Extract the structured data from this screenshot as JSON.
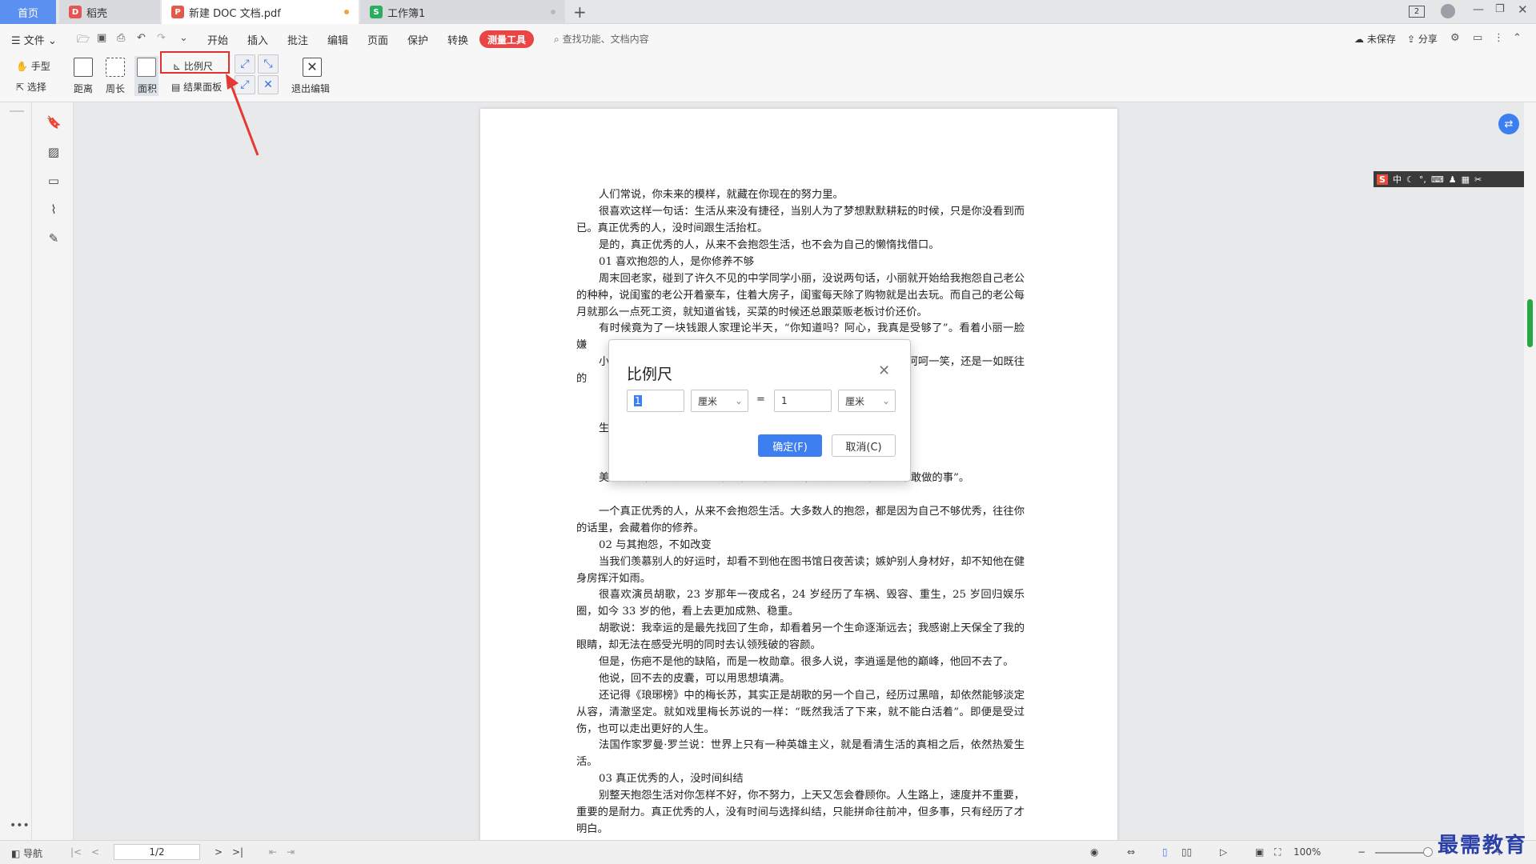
{
  "tabs": {
    "home": "首页",
    "t1": "稻壳",
    "t2": "新建 DOC 文档.pdf",
    "t3": "工作簿1",
    "add": "+"
  },
  "titlebar": {
    "badge": "2"
  },
  "menubar": {
    "file": "文件",
    "items": [
      "开始",
      "插入",
      "批注",
      "编辑",
      "页面",
      "保护",
      "转换"
    ],
    "active": "测量工具",
    "search_placeholder": "查找功能、文档内容",
    "unsaved": "未保存",
    "share": "分享"
  },
  "ribbon": {
    "hand": "手型",
    "select": "选择",
    "distance": "距离",
    "perimeter": "周长",
    "area": "面积",
    "scale": "比例尺",
    "result_panel": "结果面板",
    "exit_edit": "退出编辑"
  },
  "document": {
    "paragraphs": [
      "人们常说，你未来的模样，就藏在你现在的努力里。",
      "很喜欢这样一句话：生活从来没有捷径，当别人为了梦想默默耕耘的时候，只是你没看到而已。真正优秀的人，没时间跟生活抬杠。",
      "是的，真正优秀的人，从来不会抱怨生活，也不会为自己的懒惰找借口。",
      "01 喜欢抱怨的人，是你修养不够",
      "周末回老家，碰到了许久不见的中学同学小丽，没说两句话，小丽就开始给我抱怨自己老公的种种，说闺蜜的老公开着豪车，住着大房子，闺蜜每天除了购物就是出去玩。而自己的老公每月就那么一点死工资，就知道省钱，买菜的时候还总跟菜贩老板讨价还价。",
      "有时候竟为了一块钱跟人家理论半天，“你知道吗？阿心，我真是受够了”。看着小丽一脸嫌",
      "小                                                                                真心的好。还记得当初小丽经                                                                嫁了个好老公。可现在结婚还                                                                是呵呵一笑，还是一如既往的",
      "生                                                                                各种抱怨，就连自己最亲近的                                                                中的一些琐事，是爱人的一些",
      "美                                                                                的本质，其实是为了获取同情心和注意力，以及避免去做我们不敢做的事”。",
      "一个真正优秀的人，从来不会抱怨生活。大多数人的抱怨，都是因为自己不够优秀，往往你的话里，会藏着你的修养。",
      "02 与其抱怨，不如改变",
      "当我们羡慕别人的好运时，却看不到他在图书馆日夜苦读；嫉妒别人身材好，却不知他在健身房挥汗如雨。",
      "很喜欢演员胡歌，23 岁那年一夜成名，24 岁经历了车祸、毁容、重生，25 岁回归娱乐圈，如今 33 岁的他，看上去更加成熟、稳重。",
      "胡歌说：我幸运的是最先找回了生命，却看着另一个生命逐渐远去；我感谢上天保全了我的眼睛，却无法在感受光明的同时去认领残破的容颜。",
      "但是，伤疤不是他的缺陷，而是一枚勋章。很多人说，李逍遥是他的巅峰，他回不去了。",
      "他说，回不去的皮囊，可以用思想填满。",
      "还记得《琅琊榜》中的梅长苏，其实正是胡歌的另一个自己，经历过黑暗，却依然能够淡定从容，清澈坚定。就如戏里梅长苏说的一样：“既然我活了下来，就不能白活着”。即便是受过伤，也可以走出更好的人生。",
      "法国作家罗曼·罗兰说：世界上只有一种英雄主义，就是看清生活的真相之后，依然热爱生活。",
      "03 真正优秀的人，没时间纠结",
      "别整天抱怨生活对你怎样不好，你不努力，上天又怎会眷顾你。人生路上，速度并不重要，重要的是耐力。真正优秀的人，没有时间与选择纠结，只能拼命往前冲，但多事，只有经历了才明白。"
    ]
  },
  "dialog": {
    "title": "比例尺",
    "left_value": "1",
    "left_unit": "厘米",
    "equals": "=",
    "right_value": "1",
    "right_unit": "厘米",
    "ok": "确定(F)",
    "cancel": "取消(C)"
  },
  "statusbar": {
    "nav": "导航",
    "page": "1/2",
    "zoom": "100%"
  },
  "ime": {
    "label": "中"
  },
  "watermark": "最需教育",
  "colors": {
    "accent": "#e94545",
    "brand": "#3d7ef0",
    "highlight_box": "#e03030"
  }
}
